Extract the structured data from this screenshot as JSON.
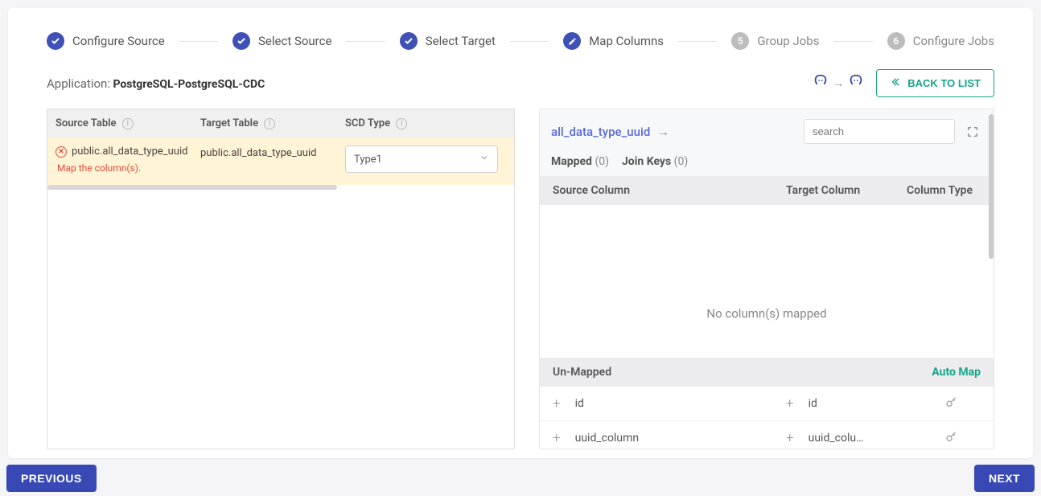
{
  "stepper": {
    "steps": [
      {
        "label": "Configure Source",
        "state": "done"
      },
      {
        "label": "Select Source",
        "state": "done"
      },
      {
        "label": "Select Target",
        "state": "done"
      },
      {
        "label": "Map Columns",
        "state": "current"
      },
      {
        "label": "Group Jobs",
        "state": "pending",
        "num": "5"
      },
      {
        "label": "Configure Jobs",
        "state": "pending",
        "num": "6"
      }
    ]
  },
  "app": {
    "label": "Application:",
    "name": "PostgreSQL-PostgreSQL-CDC",
    "back_btn": "BACK TO LIST"
  },
  "left": {
    "headers": {
      "source": "Source Table",
      "target": "Target Table",
      "scd": "SCD Type"
    },
    "row": {
      "source": "public.all_data_type_uuid",
      "target": "public.all_data_type_uuid",
      "error": "Map the column(s).",
      "scd_value": "Type1"
    }
  },
  "right": {
    "title": "all_data_type_uuid",
    "search_placeholder": "search",
    "tabs": {
      "mapped_label": "Mapped",
      "mapped_count": "(0)",
      "join_label": "Join Keys",
      "join_count": "(0)"
    },
    "col_headers": {
      "source": "Source Column",
      "target": "Target Column",
      "type": "Column Type"
    },
    "empty_text": "No column(s) mapped",
    "unmapped_label": "Un-Mapped",
    "automap_label": "Auto Map",
    "unmapped": [
      {
        "source": "id",
        "target": "id"
      },
      {
        "source": "uuid_column",
        "target": "uuid_colu…"
      }
    ]
  },
  "footer": {
    "prev": "PREVIOUS",
    "next": "NEXT"
  }
}
